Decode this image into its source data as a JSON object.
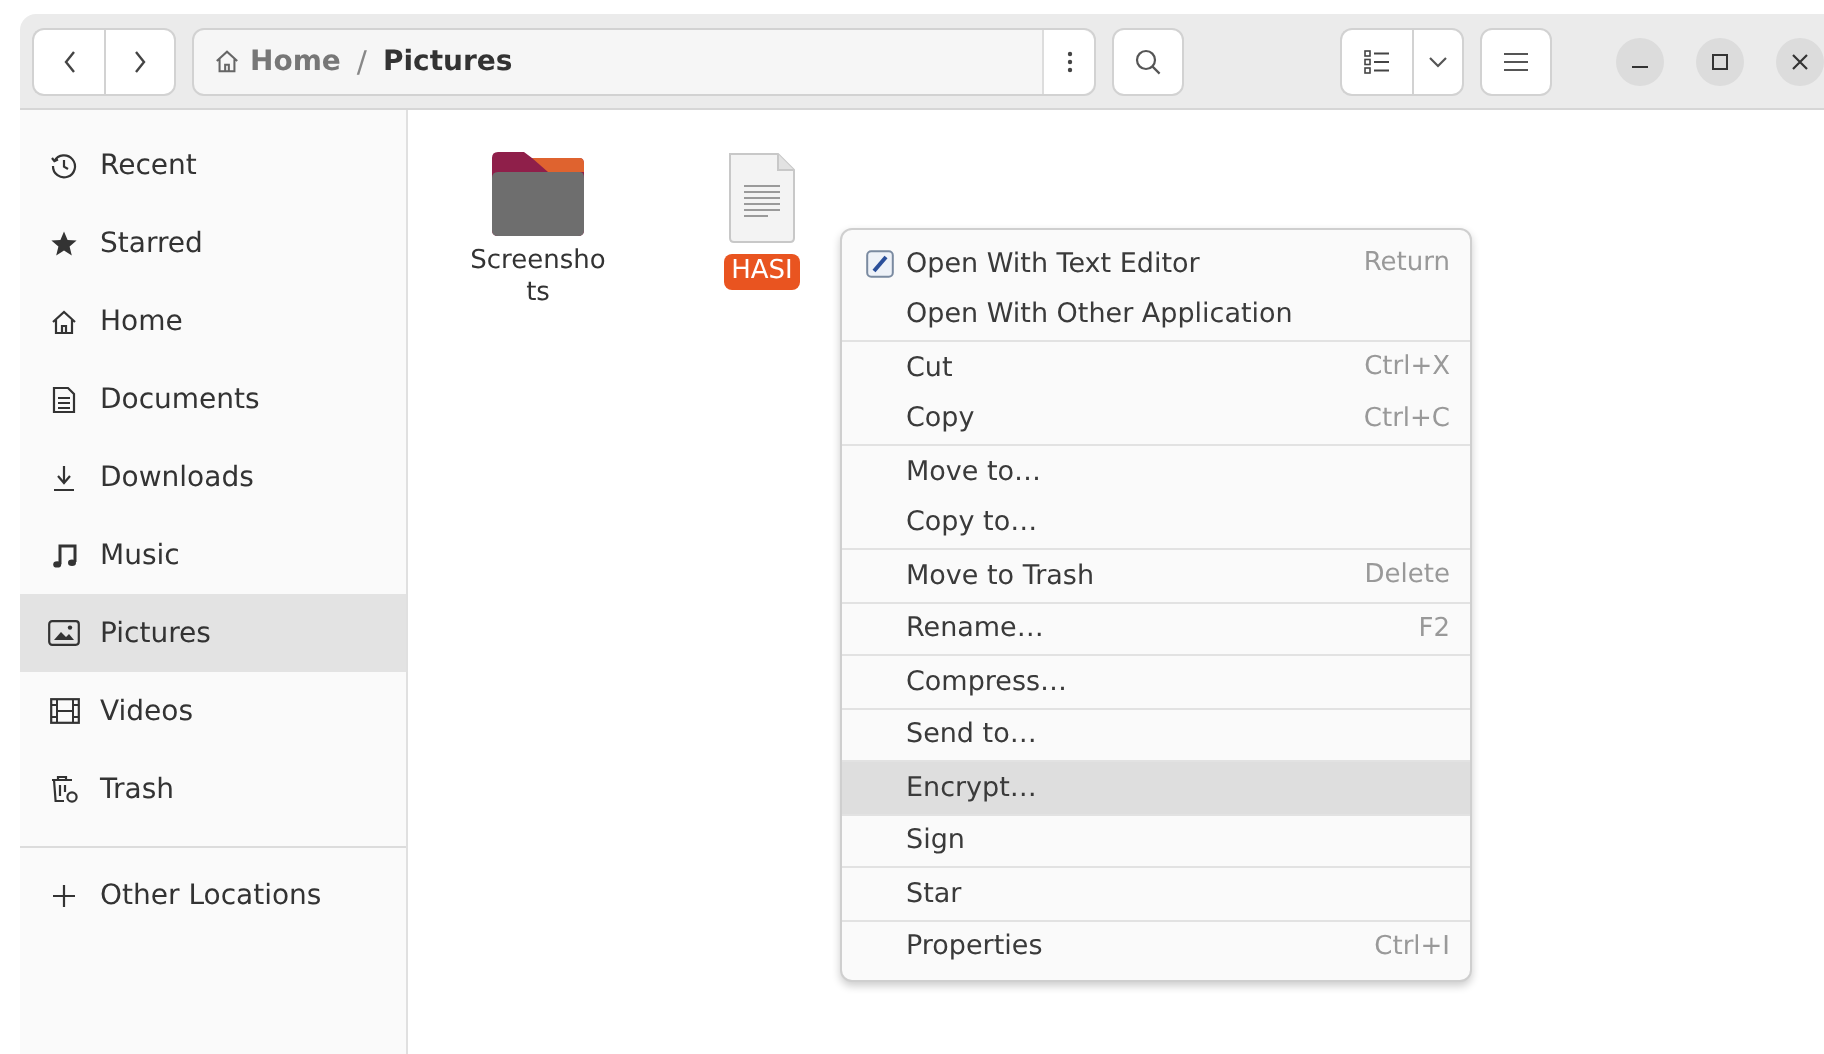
{
  "path_bar": {
    "segments": [
      {
        "label": "Home",
        "kind": "home"
      },
      {
        "label": "/",
        "kind": "separator"
      },
      {
        "label": "Pictures",
        "kind": "current"
      }
    ]
  },
  "sidebar": {
    "items": [
      {
        "label": "Recent",
        "selected": false
      },
      {
        "label": "Starred",
        "selected": false
      },
      {
        "label": "Home",
        "selected": false
      },
      {
        "label": "Documents",
        "selected": false
      },
      {
        "label": "Downloads",
        "selected": false
      },
      {
        "label": "Music",
        "selected": false
      },
      {
        "label": "Pictures",
        "selected": true
      },
      {
        "label": "Videos",
        "selected": false
      },
      {
        "label": "Trash",
        "selected": false
      }
    ],
    "other": {
      "label": "Other Locations"
    }
  },
  "files": [
    {
      "name": "Screenshots",
      "kind": "folder",
      "selected": false
    },
    {
      "name": "HASI",
      "kind": "text",
      "selected": true
    }
  ],
  "context_menu": {
    "items": [
      {
        "label": "Open With Text Editor",
        "shortcut": "Return",
        "icon": true,
        "separator": false,
        "selected": false
      },
      {
        "label": "Open With Other Application",
        "separator": false,
        "selected": false
      },
      {
        "label": "Cut",
        "shortcut": "Ctrl+X",
        "separator": true,
        "selected": false
      },
      {
        "label": "Copy",
        "shortcut": "Ctrl+C",
        "separator": false,
        "selected": false
      },
      {
        "label": "Move to…",
        "separator": true,
        "selected": false
      },
      {
        "label": "Copy to…",
        "separator": false,
        "selected": false
      },
      {
        "label": "Move to Trash",
        "shortcut": "Delete",
        "separator": true,
        "selected": false
      },
      {
        "label": "Rename…",
        "shortcut": "F2",
        "separator": true,
        "selected": false
      },
      {
        "label": "Compress…",
        "separator": true,
        "selected": false
      },
      {
        "label": "Send to…",
        "separator": true,
        "selected": false
      },
      {
        "label": "Encrypt…",
        "separator": true,
        "selected": true
      },
      {
        "label": "Sign",
        "separator": true,
        "selected": false
      },
      {
        "label": "Star",
        "separator": true,
        "selected": false
      },
      {
        "label": "Properties",
        "shortcut": "Ctrl+I",
        "separator": true,
        "selected": false
      }
    ]
  }
}
